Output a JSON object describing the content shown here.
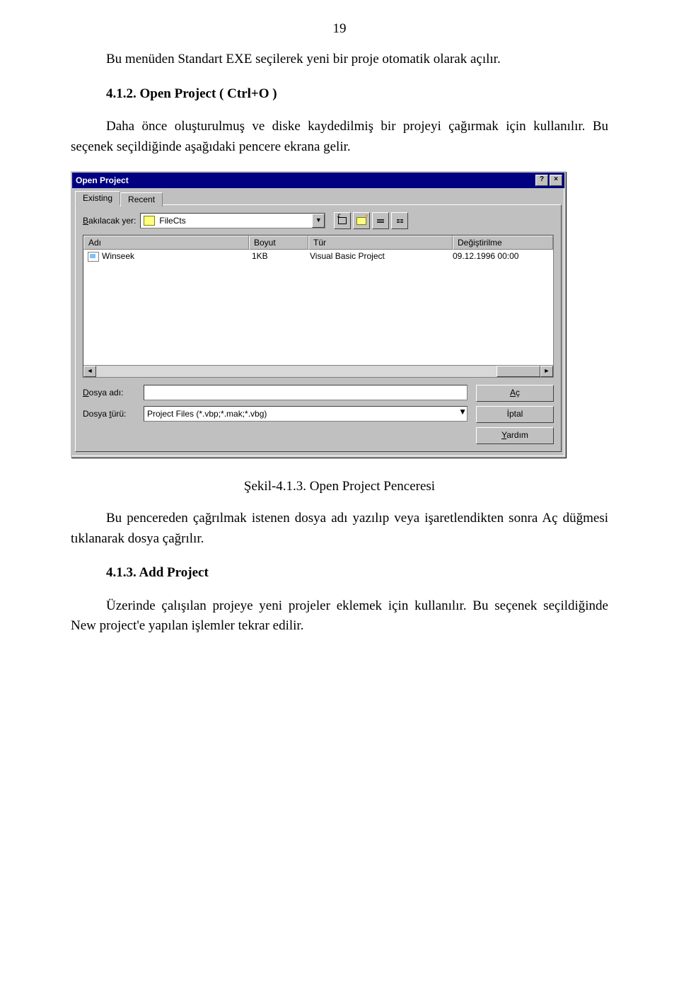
{
  "page_number": "19",
  "para1": "Bu menüden Standart EXE seçilerek yeni bir proje otomatik olarak  açılır.",
  "heading1": "4.1.2. Open Project ( Ctrl+O )",
  "para2": "Daha önce oluşturulmuş ve diske kaydedilmiş bir projeyi çağırmak için kullanılır. Bu seçenek seçildiğinde aşağıdaki pencere ekrana gelir.",
  "figure_caption": "Şekil-4.1.3. Open Project Penceresi",
  "para3": "Bu pencereden çağrılmak istenen dosya adı yazılıp veya işaretlendikten sonra Aç düğmesi tıklanarak dosya çağrılır.",
  "heading2": "4.1.3. Add Project",
  "para4": "Üzerinde çalışılan projeye yeni projeler eklemek için kullanılır. Bu seçenek seçildiğinde New project'e yapılan işlemler tekrar edilir.",
  "dialog": {
    "title": "Open Project",
    "help_btn": "?",
    "close_btn": "×",
    "tabs": {
      "existing": "Existing",
      "recent": "Recent"
    },
    "lookin_label_pre": "B",
    "lookin_label_rest": "akılacak yer:",
    "lookin_value": "FileCts",
    "columns": {
      "name": "Adı",
      "size": "Boyut",
      "type": "Tür",
      "modified": "Değiştirilme"
    },
    "rows": [
      {
        "name": "Winseek",
        "size": "1KB",
        "type": "Visual Basic Project",
        "modified": "09.12.1996 00:00"
      }
    ],
    "scroll_left": "◄",
    "scroll_right": "►",
    "filename_label_pre": "D",
    "filename_label_rest": "osya adı:",
    "filename_value": "",
    "filetype_label_pre": "Dosya ",
    "filetype_label_u": "t",
    "filetype_label_rest": "ürü:",
    "filetype_value": "Project Files (*.vbp;*.mak;*.vbg)",
    "combo_arrow": "▼",
    "btn_open_u": "A",
    "btn_open_rest": "ç",
    "btn_cancel": "İptal",
    "btn_help_u": "Y",
    "btn_help_rest": "ardım"
  }
}
